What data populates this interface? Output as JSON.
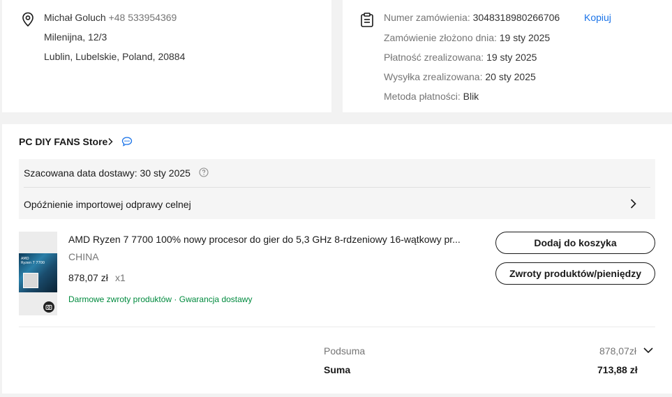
{
  "address": {
    "name": "Michał Goluch",
    "phone": "+48 533954369",
    "street": "Milenijna, 12/3",
    "city": "Lublin, Lubelskie, Poland, 20884",
    "icon": "location-pin-icon"
  },
  "order": {
    "icon": "clipboard-icon",
    "number_label": "Numer zamówienia:",
    "number_value": "3048318980266706",
    "copy_label": "Kopiuj",
    "placed_label": "Zamówienie złożono dnia:",
    "placed_value": "19 sty 2025",
    "paid_label": "Płatność zrealizowana:",
    "paid_value": "19 sty 2025",
    "shipped_label": "Wysyłka zrealizowana:",
    "shipped_value": "20 sty 2025",
    "method_label": "Metoda płatności:",
    "method_value": "Blik"
  },
  "store": {
    "name": "PC DIY FANS Store",
    "chat_icon": "chat-bubble-icon"
  },
  "delivery": {
    "estimate_text": "Szacowana data dostawy: 30 sty 2025",
    "delay_text": "Opóźnienie importowej odprawy celnej"
  },
  "product": {
    "title": "AMD Ryzen 7 7700 100% nowy procesor do gier do 5,3 GHz 8-rdzeniowy 16-wątkowy pr...",
    "origin": "CHINA",
    "price": "878,07 zł",
    "qty": "x1",
    "image_label": "AMD\nRyzen 7 7700",
    "badge_free_returns": "Darmowe zwroty produktów",
    "badge_separator": "·",
    "badge_delivery_guarantee": "Gwarancja dostawy"
  },
  "actions": {
    "add_to_cart": "Dodaj do koszyka",
    "returns": "Zwroty produktów/pieniędzy"
  },
  "summary": {
    "subtotal_label": "Podsuma",
    "subtotal_value": "878,07zł",
    "total_label": "Suma",
    "total_value": "713,88 zł"
  },
  "colors": {
    "link": "#1a73e8",
    "success_green": "#008a3e",
    "muted_text": "#757575",
    "page_background": "#f2f2f2"
  }
}
